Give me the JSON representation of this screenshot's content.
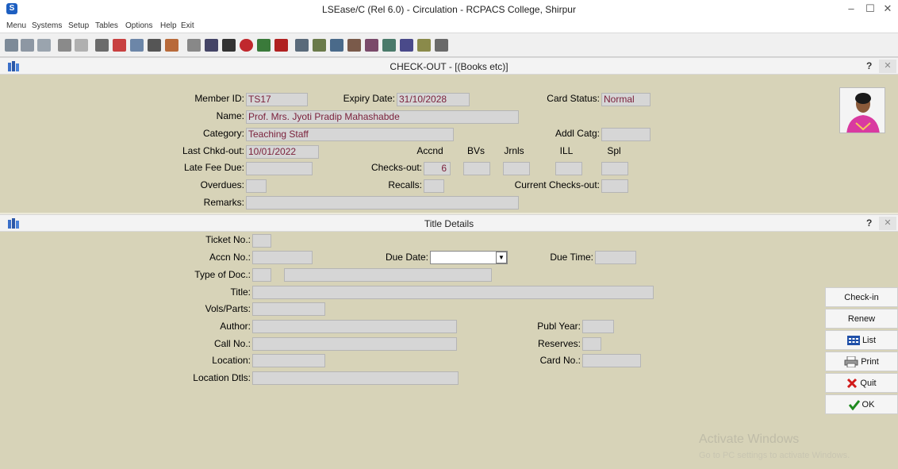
{
  "window": {
    "title": "LSEase/C (Rel 6.0) - Circulation - RCPACS College, Shirpur",
    "app_icon_letter": "S",
    "minimize": "–",
    "maximize": "☐",
    "close": "✕"
  },
  "menu": [
    "Menu",
    "Systems",
    "Setup",
    "Tables",
    "Options",
    "Help",
    "Exit"
  ],
  "checkout_panel": {
    "title": "CHECK-OUT - [(Books etc)]",
    "help": "?",
    "close": "✕",
    "labels": {
      "member_id": "Member ID:",
      "expiry_date": "Expiry Date:",
      "card_status": "Card Status:",
      "name": "Name:",
      "category": "Category:",
      "addl_catg": "Addl Catg:",
      "last_chkd_out": "Last Chkd-out:",
      "accnd": "Accnd",
      "bvs": "BVs",
      "jrnls": "Jrnls",
      "ill": "ILL",
      "spl": "Spl",
      "late_fee_due": "Late Fee Due:",
      "checks_out": "Checks-out:",
      "overdues": "Overdues:",
      "recalls": "Recalls:",
      "current_checks_out": "Current Checks-out:",
      "remarks": "Remarks:"
    },
    "values": {
      "member_id": "TS17",
      "expiry_date": "31/10/2028",
      "card_status": "Normal",
      "name": "Prof. Mrs. Jyoti Pradip Mahashabde",
      "category": "Teaching Staff",
      "addl_catg": "",
      "last_chkd_out": "10/01/2022",
      "late_fee_due": "",
      "checks_out_accnd": "6",
      "checks_out_bvs": "",
      "checks_out_jrnls": "",
      "checks_out_ill": "",
      "checks_out_spl": "",
      "overdues": "",
      "recalls": "",
      "current_checks_out": "",
      "remarks": ""
    }
  },
  "title_panel": {
    "title": "Title Details",
    "help": "?",
    "close": "✕",
    "labels": {
      "ticket_no": "Ticket No.:",
      "accn_no": "Accn No.:",
      "due_date": "Due Date:",
      "due_time": "Due Time:",
      "type_of_doc": "Type of Doc.:",
      "title": "Title:",
      "vols_parts": "Vols/Parts:",
      "author": "Author:",
      "publ_year": "Publ Year:",
      "call_no": "Call No.:",
      "reserves": "Reserves:",
      "location": "Location:",
      "card_no": "Card No.:",
      "location_dtls": "Location Dtls:"
    },
    "values": {
      "ticket_no": "",
      "accn_no": "",
      "due_date": "",
      "due_time": "",
      "type_of_doc_code": "",
      "type_of_doc_name": "",
      "title": "",
      "vols_parts": "",
      "author": "",
      "publ_year": "",
      "call_no": "",
      "reserves": "",
      "location": "",
      "card_no": "",
      "location_dtls": ""
    }
  },
  "side_buttons": {
    "checkin": "Check-in",
    "renew": "Renew",
    "list": "List",
    "print": "Print",
    "quit": "Quit",
    "ok": "OK"
  },
  "watermark": {
    "line1": "Activate Windows",
    "line2": "Go to PC settings to activate Windows."
  },
  "colors": {
    "panel_bg": "#d7d3b8",
    "field_bg": "#d6d6d6",
    "field_text": "#7a1f3a"
  }
}
